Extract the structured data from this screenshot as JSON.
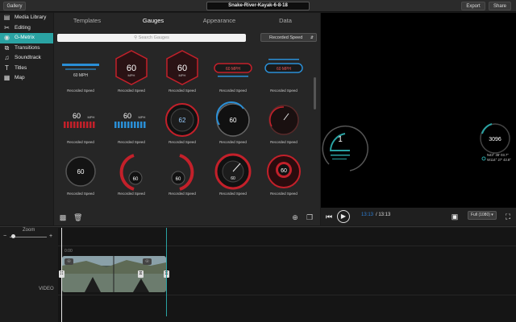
{
  "topbar": {
    "gallery_label": "Gallery",
    "project_title": "Snake-River-Kayak-6-8-18",
    "export_label": "Export",
    "share_label": "Share"
  },
  "sidebar": {
    "items": [
      {
        "label": "Media Library",
        "icon": "film-icon",
        "active": false
      },
      {
        "label": "Editing",
        "icon": "scissors-icon",
        "active": false
      },
      {
        "label": "G-Metrix",
        "icon": "eye-icon",
        "active": true
      },
      {
        "label": "Transitions",
        "icon": "transitions-icon",
        "active": false
      },
      {
        "label": "Soundtrack",
        "icon": "music-note-icon",
        "active": false
      },
      {
        "label": "Titles",
        "icon": "titles-icon",
        "active": false
      },
      {
        "label": "Map",
        "icon": "map-icon",
        "active": false
      }
    ]
  },
  "panel": {
    "tabs": [
      "Templates",
      "Gauges",
      "Appearance",
      "Data"
    ],
    "active_tab": "Gauges",
    "search_placeholder": "Search Gauges",
    "filter_value": "Recorded Speed",
    "gauges": [
      {
        "label": "Recorded Speed",
        "style": "bar-blue",
        "value": "60 MPH"
      },
      {
        "label": "Recorded Speed",
        "style": "hex-red",
        "value": "60",
        "unit": "MPH"
      },
      {
        "label": "Recorded Speed",
        "style": "hex-red",
        "value": "60",
        "unit": "MPH"
      },
      {
        "label": "Recorded Speed",
        "style": "pill-red",
        "value": "60 MPH"
      },
      {
        "label": "Recorded Speed",
        "style": "pill-blue",
        "value": "60 MPH"
      },
      {
        "label": "Recorded Speed",
        "style": "bars-red",
        "value": "60",
        "unit": "MPH"
      },
      {
        "label": "Recorded Speed",
        "style": "bars-blue",
        "value": "60",
        "unit": "MPH"
      },
      {
        "label": "Recorded Speed",
        "style": "dial-red",
        "value": "62"
      },
      {
        "label": "Recorded Speed",
        "style": "dial-blue",
        "value": "60"
      },
      {
        "label": "Recorded Speed",
        "style": "dial-dark",
        "value": ""
      },
      {
        "label": "Recorded Speed",
        "style": "ring-dark",
        "value": "60"
      },
      {
        "label": "Recorded Speed",
        "style": "arc-left",
        "value": "60"
      },
      {
        "label": "Recorded Speed",
        "style": "arc-right",
        "value": "60"
      },
      {
        "label": "Recorded Speed",
        "style": "dial-red-big",
        "value": "60"
      },
      {
        "label": "Recorded Speed",
        "style": "disc-red",
        "value": "60"
      }
    ]
  },
  "viewer": {
    "left_gauge_value": "1",
    "right_gauge_value": "3096",
    "right_coord_1": "N43° 38' 03.7\"",
    "right_coord_2": "W114° 27' 43.8\""
  },
  "playbar": {
    "time_current": "13:13",
    "time_separator_total": "/ 13:13",
    "quality": "Full (1080)"
  },
  "timeline": {
    "zoom_label": "Zoom",
    "zoom_minus": "−",
    "zoom_plus": "+",
    "zoom_level": 0.1,
    "time_marker": "0:00",
    "track_label": "VIDEO"
  },
  "colors": {
    "accent": "#2aa3a3",
    "gauge_red": "#c3202a",
    "gauge_blue": "#2a8fd6",
    "time_blue": "#2d7fd6"
  }
}
